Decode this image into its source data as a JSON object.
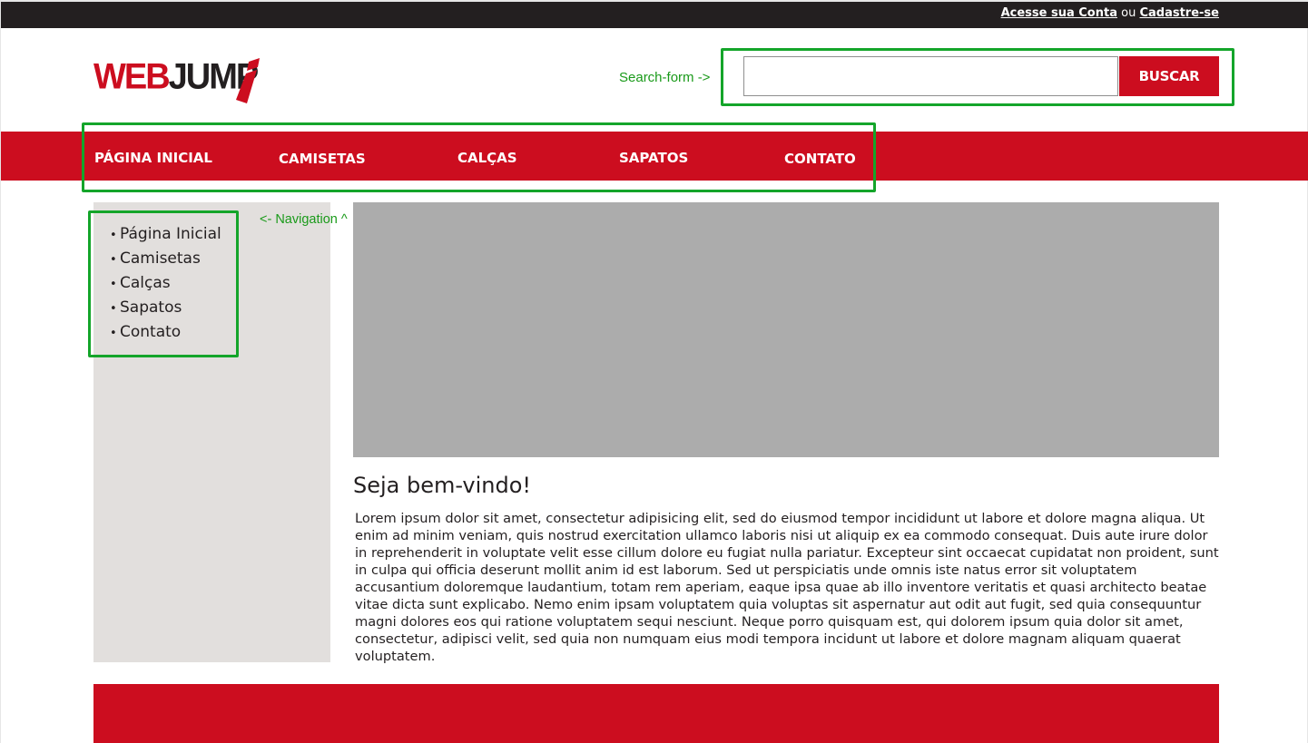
{
  "topbar": {
    "login_link": "Acesse sua Conta",
    "separator": "ou",
    "register_link": "Cadastre-se"
  },
  "logo": {
    "part1": "WEB",
    "part2": "JUMP",
    "alt": "WEBJUMP"
  },
  "annotations": {
    "search_form": "Search-form ->",
    "navigation": "<- Navigation ^"
  },
  "search": {
    "value": "",
    "placeholder": "",
    "button_label": "BUSCAR"
  },
  "nav": {
    "items": [
      "PÁGINA INICIAL",
      "CAMISETAS",
      "CALÇAS",
      "SAPATOS",
      "CONTATO"
    ]
  },
  "sidebar": {
    "bullet": "•",
    "items": [
      "Página Inicial",
      "Camisetas",
      "Calças",
      "Sapatos",
      "Contato"
    ]
  },
  "main": {
    "title": "Seja bem-vindo!",
    "text": "Lorem ipsum dolor sit amet, consectetur adipisicing elit, sed do eiusmod tempor incididunt ut labore et dolore magna aliqua. Ut enim ad minim veniam, quis nostrud exercitation ullamco laboris nisi ut aliquip ex ea commodo consequat. Duis aute irure dolor in reprehenderit in voluptate velit esse cillum dolore eu fugiat nulla pariatur. Excepteur sint occaecat cupidatat non proident, sunt in culpa qui officia deserunt mollit anim id est laborum. Sed ut perspiciatis unde omnis iste natus error sit voluptatem accusantium doloremque laudantium, totam rem aperiam, eaque ipsa quae ab illo inventore veritatis et quasi architecto beatae vitae dicta sunt explicabo. Nemo enim ipsam voluptatem quia voluptas sit aspernatur aut odit aut fugit, sed quia consequuntur magni dolores eos qui ratione voluptatem sequi nesciunt. Neque porro quisquam est, qui dolorem ipsum quia dolor sit amet, consectetur, adipisci velit, sed quia non numquam eius modi tempora incidunt ut labore et dolore magnam aliquam quaerat voluptatem."
  },
  "colors": {
    "brand_red": "#cc0d1f",
    "topbar_dark": "#231f20",
    "sidebar_bg": "#e2dfdd",
    "banner_gray": "#acacac",
    "annotation_green": "#14a52a"
  }
}
